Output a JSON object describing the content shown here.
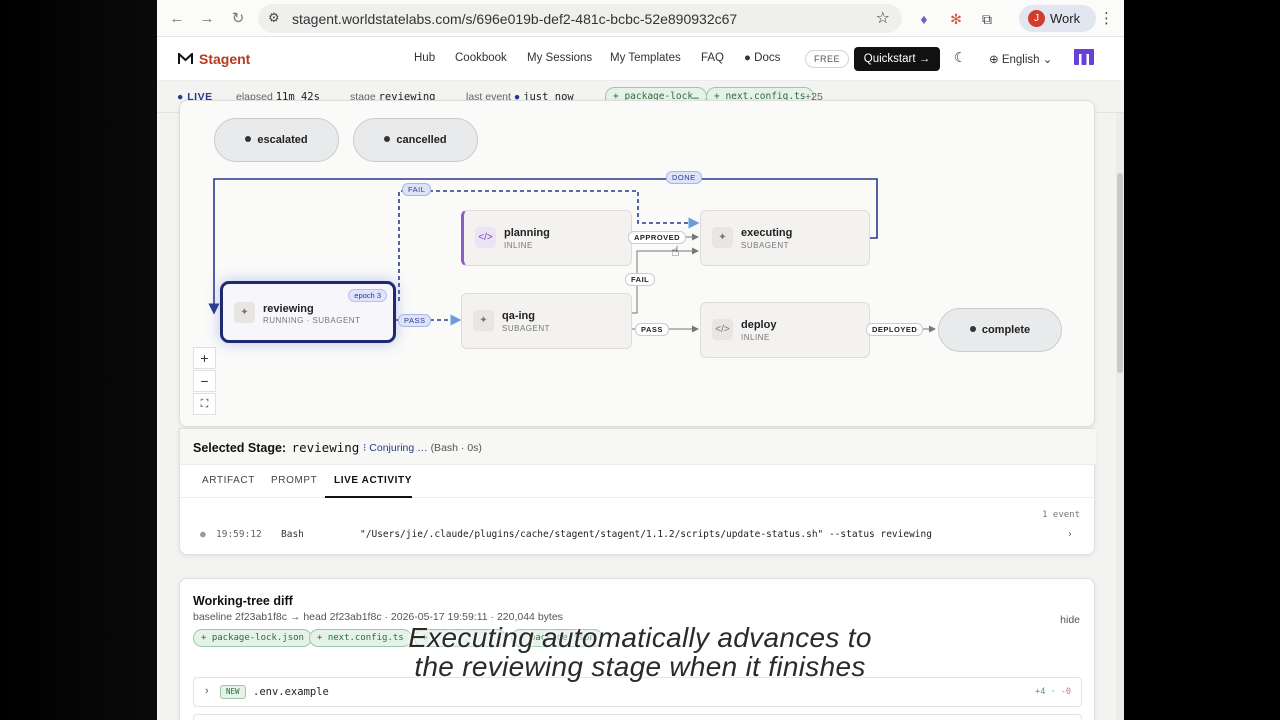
{
  "browser": {
    "url": "stagent.worldstatelabs.com/s/696e019b-def2-481c-bcbc-52e890932c67",
    "profile_initial": "J",
    "profile_label": "Work"
  },
  "header": {
    "brand_prefix": "",
    "brand_name": "Stagent",
    "nav": [
      "Hub",
      "Cookbook",
      "My Sessions",
      "My Templates",
      "FAQ",
      "Docs"
    ],
    "free_badge": "FREE",
    "quickstart": "Quickstart →",
    "language": "English"
  },
  "status": {
    "live": "LIVE",
    "elapsed_label": "elapsed",
    "elapsed_value": "11m 42s",
    "stage_label": "stage",
    "stage_value": "reviewing",
    "last_event_label": "last event",
    "last_event_value": "just now",
    "chips": [
      "+ package-lock…",
      "+ next.config.ts"
    ],
    "more": "+25"
  },
  "graph": {
    "terminal_top": [
      {
        "name": "escalated"
      },
      {
        "name": "cancelled"
      }
    ],
    "nodes": {
      "planning": {
        "name": "planning",
        "sub": "INLINE"
      },
      "executing": {
        "name": "executing",
        "sub": "SUBAGENT"
      },
      "reviewing": {
        "name": "reviewing",
        "sub": "RUNNING · SUBAGENT",
        "epoch": "epoch 3"
      },
      "qaing": {
        "name": "qa-ing",
        "sub": "SUBAGENT"
      },
      "deploy": {
        "name": "deploy",
        "sub": "INLINE"
      },
      "complete": {
        "name": "complete"
      }
    },
    "edge_labels": {
      "fail_top": "FAIL",
      "done": "DONE",
      "approved": "APPROVED",
      "fail_mid": "FAIL",
      "pass_left": "PASS",
      "pass_right": "PASS",
      "deployed": "DEPLOYED"
    }
  },
  "selected": {
    "title": "Selected Stage:",
    "stage": "reviewing",
    "conjuring": "Conjuring …",
    "conjuring_detail": "(Bash · 0s)",
    "tabs": [
      "ARTIFACT",
      "PROMPT",
      "LIVE ACTIVITY"
    ],
    "event_count": "1 event",
    "event": {
      "time": "19:59:12",
      "tool": "Bash",
      "command": "\"/Users/jie/.claude/plugins/cache/stagent/stagent/1.1.2/scripts/update-status.sh\" --status reviewing"
    }
  },
  "diff": {
    "title": "Working-tree diff",
    "meta": "baseline 2f23ab1f8c → head 2f23ab1f8c · 2026-05-17 19:59:11 · 220,044 bytes",
    "hide": "hide",
    "chips": [
      "+ package-lock.json",
      "+ next.config.ts",
      "+ ",
      "+ package.json"
    ],
    "file": {
      "badge": "NEW",
      "name": ".env.example",
      "added": "+4",
      "removed": "-0"
    }
  },
  "caption": {
    "line1": "Executing automatically advances to",
    "line2": "the reviewing stage when it finishes"
  }
}
